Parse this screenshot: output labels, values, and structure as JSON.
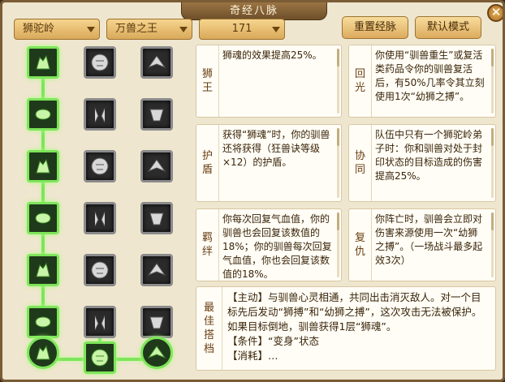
{
  "title": "奇经八脉",
  "close_label": "✕",
  "dropdowns": [
    {
      "value": "狮驼岭"
    },
    {
      "value": "万兽之王"
    },
    {
      "value": "171"
    }
  ],
  "buttons": {
    "reset": "重置经脉",
    "default": "默认模式"
  },
  "tree": {
    "rows": [
      [
        {
          "icon": "lion-head-icon",
          "state": "on"
        },
        {
          "icon": "lion-face-icon",
          "state": "off"
        },
        {
          "icon": "beast-roar-icon",
          "state": "off"
        }
      ],
      [
        {
          "icon": "beast-heal-icon",
          "state": "on"
        },
        {
          "icon": "wolf-claw-icon",
          "state": "off"
        },
        {
          "icon": "stone-beast-icon",
          "state": "off"
        }
      ],
      [
        {
          "icon": "armor-icon",
          "state": "on"
        },
        {
          "icon": "beast-hide-icon",
          "state": "off"
        },
        {
          "icon": "charging-lion-icon",
          "state": "off"
        }
      ],
      [
        {
          "icon": "lion-cub-icon",
          "state": "on"
        },
        {
          "icon": "swords-icon",
          "state": "off"
        },
        {
          "icon": "dragon-icon",
          "state": "off"
        }
      ],
      [
        {
          "icon": "rabbit-spirit-icon",
          "state": "on"
        },
        {
          "icon": "bone-icon",
          "state": "off"
        },
        {
          "icon": "panther-icon",
          "state": "off"
        }
      ],
      [
        {
          "icon": "sprint-icon",
          "state": "on"
        },
        {
          "icon": "skull-plus-icon",
          "state": "off"
        },
        {
          "icon": "heart-icon",
          "state": "off"
        }
      ],
      [
        {
          "icon": "swirl-orb-icon",
          "state": "on"
        },
        {
          "icon": "wing-icon",
          "state": "on"
        },
        {
          "icon": "swirl-orb-icon",
          "state": "on"
        }
      ]
    ]
  },
  "cards": [
    {
      "label": "狮王",
      "text": "狮魂的效果提高25%。"
    },
    {
      "label": "回光",
      "text": "你使用“驯兽重生”或复活类药品令你的驯兽复活后，有50%几率令其立刻使用1次“幼狮之搏”。"
    },
    {
      "label": "护盾",
      "text": "获得“狮魂”时，你的驯兽还将获得（狂兽诀等级×12）的护盾。"
    },
    {
      "label": "协同",
      "text": "队伍中只有一个狮驼岭弟子时：你和驯兽对处于封印状态的目标造成的伤害提高25%。"
    },
    {
      "label": "羁绊",
      "text": "你每次回复气血值，你的驯兽也会回复该数值的18%；你的驯兽每次回复气血值，你也会回复该数值的18%。"
    },
    {
      "label": "复仇",
      "text": "你阵亡时，驯兽会立即对伤害来源使用一次“幼狮之搏”。（一场战斗最多起效3次）"
    }
  ],
  "best": {
    "label": "最佳搭档",
    "lines": [
      "【主动】与驯兽心灵相通，共同出击消灭敌人。对一个目标先后发动“狮搏”和“幼狮之搏”，这次攻击无法被保护。如果目标倒地，驯兽获得1层“狮魂”。",
      "【条件】“变身”状态",
      "【消耗】…"
    ]
  },
  "colors": {
    "active_border": "#7ee55a",
    "frame": "#7a5c36",
    "panel": "#efe6cf",
    "label": "#6a3e12"
  }
}
